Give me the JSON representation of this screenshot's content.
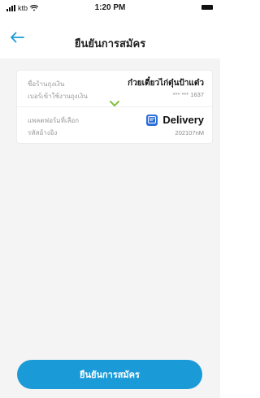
{
  "status_bar": {
    "carrier": "ktb",
    "time": "1:20 PM"
  },
  "header": {
    "title": "ยืนยันการสมัคร"
  },
  "summary": {
    "shop_name_label": "ชื่อร้านถุงเงิน",
    "shop_name_value": "ก๋วยเตี๋ยวไก่ตุ๋นป้าแต๋ว",
    "login_number_label": "เบอร์เข้าใช้งานถุงเงิน",
    "login_number_value": "*** *** 1637",
    "platform_label": "แพลตฟอร์มที่เลือก",
    "platform_value": "Delivery",
    "reference_label": "รหัสอ้างอิง",
    "reference_value": "202107nM"
  },
  "footer": {
    "confirm_label": "ยืนยันการสมัคร"
  },
  "colors": {
    "accent": "#1a9bd8",
    "chevron": "#7dc242",
    "platform_logo": "#2c6fd8"
  },
  "icons": {
    "back": "arrow-left-icon",
    "chevron": "chevron-down-icon",
    "platform": "platform-logo-icon"
  }
}
